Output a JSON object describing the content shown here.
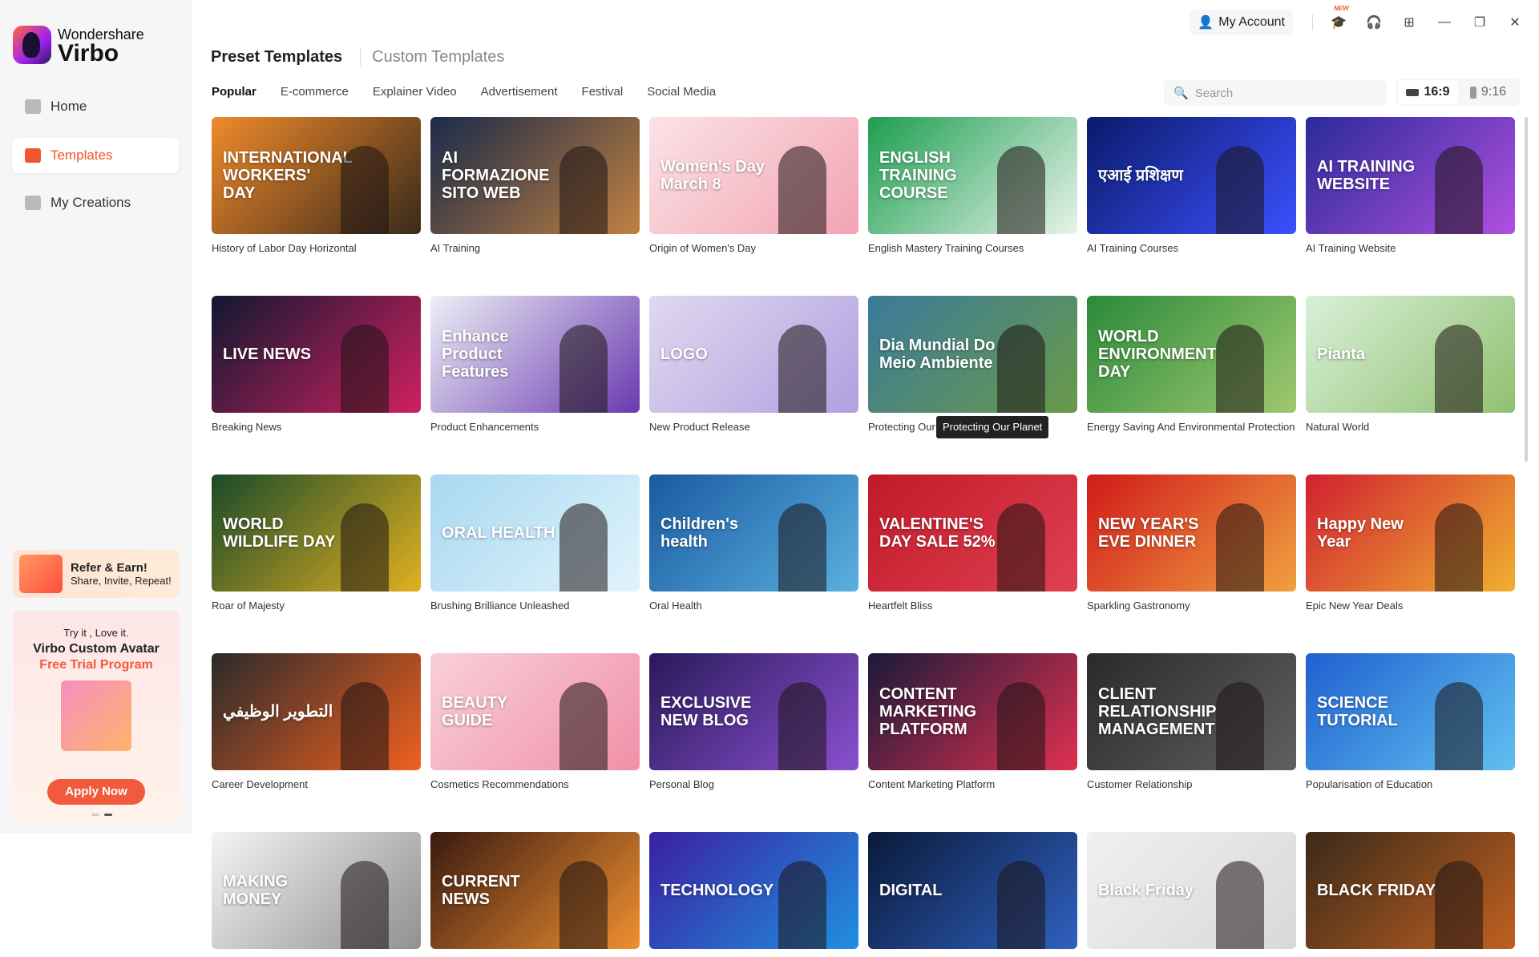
{
  "app": {
    "brand_line1": "Wondershare",
    "brand_line2": "Virbo"
  },
  "sidebar": {
    "items": [
      {
        "label": "Home",
        "icon": "home-icon"
      },
      {
        "label": "Templates",
        "icon": "templates-icon",
        "active": true
      },
      {
        "label": "My Creations",
        "icon": "creations-icon"
      }
    ],
    "refer": {
      "title": "Refer & Earn!",
      "subtitle": "Share, Invite, Repeat!"
    },
    "promo": {
      "line1": "Try it , Love it.",
      "line2": "Virbo Custom Avatar",
      "line3": "Free Trial Program",
      "button": "Apply Now"
    }
  },
  "topbar": {
    "account": "My Account",
    "new_badge": "NEW"
  },
  "header": {
    "tabs": [
      "Preset Templates",
      "Custom Templates"
    ],
    "categories": [
      "Popular",
      "E-commerce",
      "Explainer Video",
      "Advertisement",
      "Festival",
      "Social Media"
    ],
    "active_category": "Popular",
    "search_placeholder": "Search",
    "ratios": [
      "16:9",
      "9:16"
    ],
    "active_ratio": "16:9"
  },
  "accent": "#f0562c",
  "tooltip": "Protecting Our Planet",
  "templates": [
    {
      "title": "History of Labor Day Horizontal",
      "thumb": "INTERNATIONAL WORKERS' DAY",
      "c1": "#f08a2a",
      "c2": "#3a2a1a"
    },
    {
      "title": "AI Training",
      "thumb": "AI FORMAZIONE SITO WEB",
      "c1": "#1a2a4a",
      "c2": "#c08040"
    },
    {
      "title": "Origin of Women's Day",
      "thumb": "Women's Day March 8",
      "c1": "#fbe3e6",
      "c2": "#f2a3b3"
    },
    {
      "title": "English Mastery Training Courses",
      "thumb": "ENGLISH TRAINING COURSE",
      "c1": "#1e9e50",
      "c2": "#e8f3ea"
    },
    {
      "title": "AI Training Courses",
      "thumb": "एआई प्रशिक्षण",
      "c1": "#0a1a6a",
      "c2": "#3c50ff"
    },
    {
      "title": "AI Training Website",
      "thumb": "AI TRAINING WEBSITE",
      "c1": "#2a2a9a",
      "c2": "#b050e0"
    },
    {
      "title": "Breaking News",
      "thumb": "LIVE NEWS",
      "c1": "#101830",
      "c2": "#d02060"
    },
    {
      "title": "Product Enhancements",
      "thumb": "Enhance Product Features",
      "c1": "#eef0f6",
      "c2": "#6a3ab0"
    },
    {
      "title": "New Product Release",
      "thumb": "LOGO",
      "c1": "#e0d8f0",
      "c2": "#b0a0e0"
    },
    {
      "title": "Protecting Our Planet",
      "thumb": "Dia Mundial Do Meio Ambiente",
      "c1": "#3a7a9a",
      "c2": "#6a9a4a"
    },
    {
      "title": "Energy Saving And Environmental Protection",
      "thumb": "WORLD ENVIRONMENT DAY",
      "c1": "#2a8a3a",
      "c2": "#a0c870"
    },
    {
      "title": "Natural World",
      "thumb": "Pianta",
      "c1": "#d8f0d8",
      "c2": "#90c070"
    },
    {
      "title": "Roar of Majesty",
      "thumb": "WORLD WILDLIFE DAY",
      "c1": "#1a4a2a",
      "c2": "#e0b020"
    },
    {
      "title": "Brushing Brilliance Unleashed",
      "thumb": "ORAL HEALTH",
      "c1": "#a8d8f0",
      "c2": "#e0f4fc"
    },
    {
      "title": "Oral Health",
      "thumb": "Children's health",
      "c1": "#1a5aa0",
      "c2": "#5ab0e0"
    },
    {
      "title": "Heartfelt Bliss",
      "thumb": "VALENTINE'S DAY SALE 52%",
      "c1": "#c01a2a",
      "c2": "#e04050"
    },
    {
      "title": "Sparkling Gastronomy",
      "thumb": "NEW YEAR'S EVE DINNER",
      "c1": "#d01a1a",
      "c2": "#f0a040"
    },
    {
      "title": "Epic New Year Deals",
      "thumb": "Happy New Year",
      "c1": "#d02030",
      "c2": "#f0b030"
    },
    {
      "title": "Career Development",
      "thumb": "التطوير الوظيفي",
      "c1": "#2a2a2a",
      "c2": "#f06020"
    },
    {
      "title": "Cosmetics Recommendations",
      "thumb": "BEAUTY GUIDE",
      "c1": "#f8d0d8",
      "c2": "#f090a8"
    },
    {
      "title": "Personal Blog",
      "thumb": "EXCLUSIVE NEW BLOG",
      "c1": "#2a1a5a",
      "c2": "#8a50d0"
    },
    {
      "title": "Content Marketing Platform",
      "thumb": "CONTENT MARKETING PLATFORM",
      "c1": "#1a1a3a",
      "c2": "#e03050"
    },
    {
      "title": "Customer Relationship",
      "thumb": "CLIENT RELATIONSHIP MANAGEMENT",
      "c1": "#2a2a2a",
      "c2": "#606060"
    },
    {
      "title": "Popularisation of Education",
      "thumb": "SCIENCE TUTORIAL",
      "c1": "#2060d0",
      "c2": "#60c0f0"
    },
    {
      "title": "",
      "thumb": "MAKING MONEY",
      "c1": "#f4f4f4",
      "c2": "#909090"
    },
    {
      "title": "",
      "thumb": "CURRENT NEWS",
      "c1": "#3a1a10",
      "c2": "#f09030"
    },
    {
      "title": "",
      "thumb": "TECHNOLOGY",
      "c1": "#3a20a0",
      "c2": "#2090e0"
    },
    {
      "title": "",
      "thumb": "DIGITAL",
      "c1": "#0a1a3a",
      "c2": "#3060c0"
    },
    {
      "title": "",
      "thumb": "Black Friday",
      "c1": "#f0f0f0",
      "c2": "#d8d8d8"
    },
    {
      "title": "",
      "thumb": "BLACK FRIDAY",
      "c1": "#3a2a1a",
      "c2": "#c06020"
    }
  ]
}
